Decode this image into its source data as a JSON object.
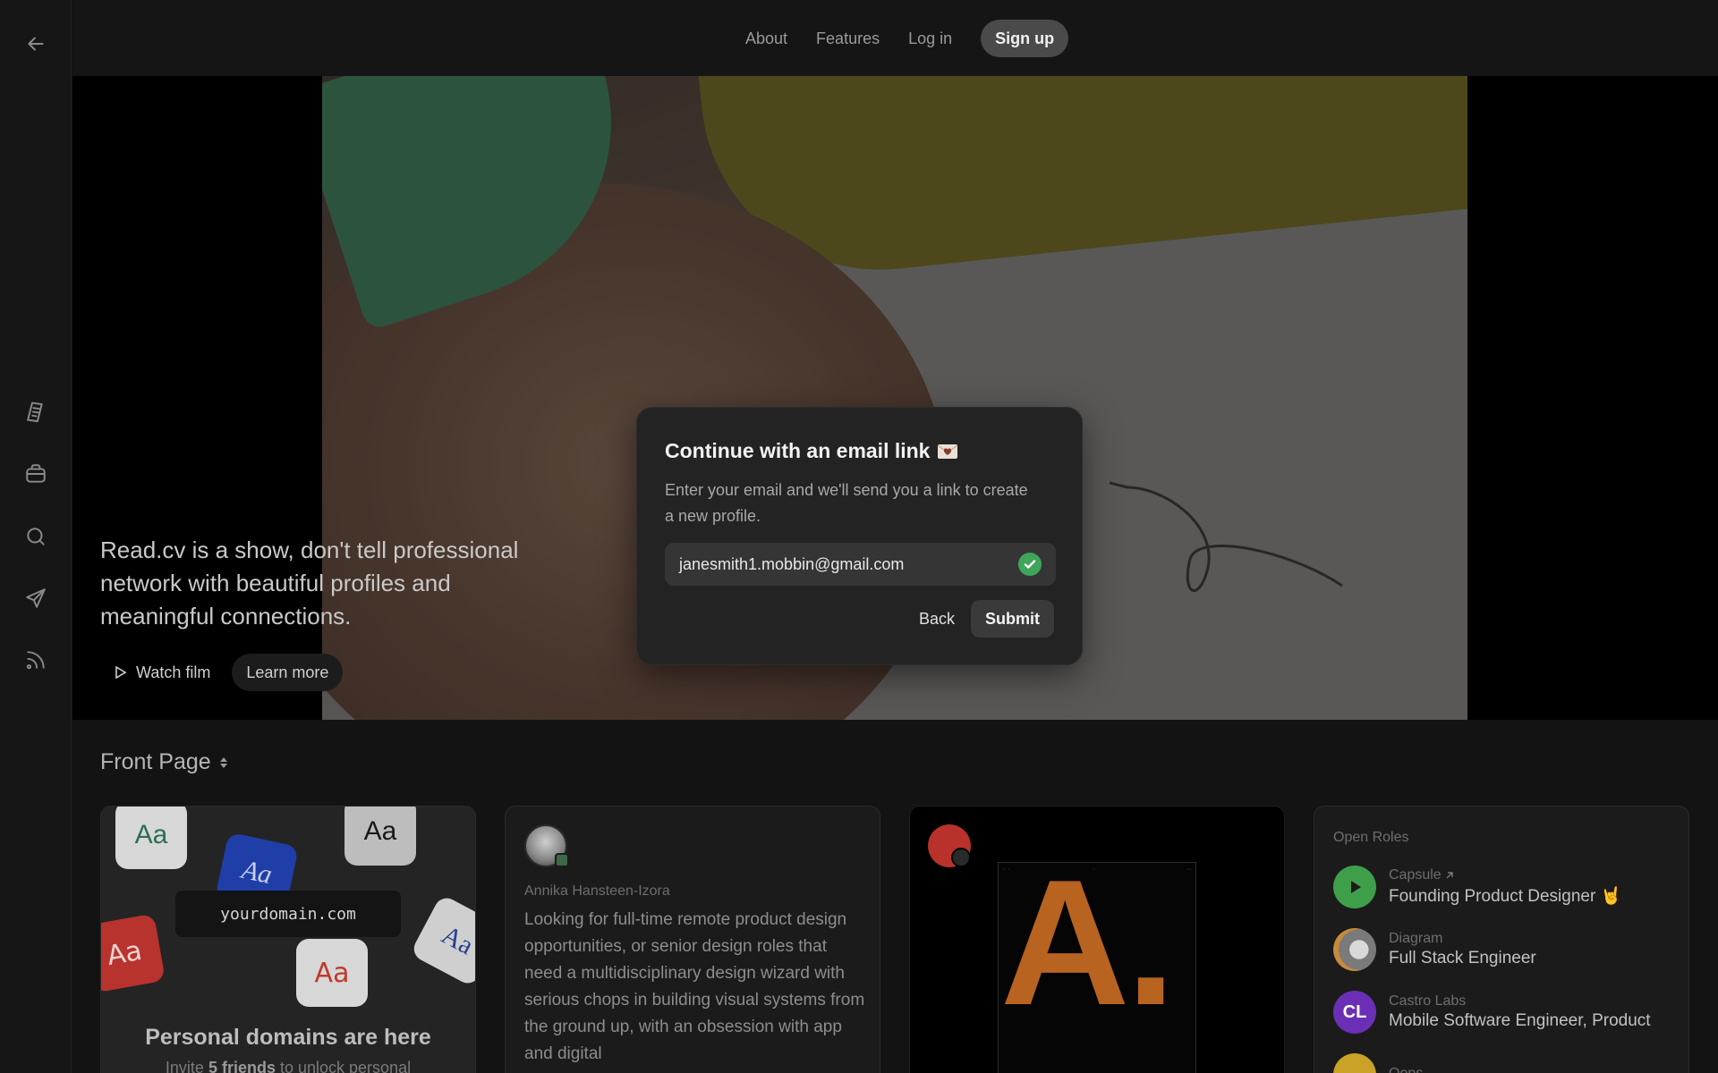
{
  "sidebar": {
    "icons": [
      "back-arrow-icon",
      "document-icon",
      "briefcase-icon",
      "search-icon",
      "send-icon",
      "rss-icon"
    ]
  },
  "nav": {
    "about": "About",
    "features": "Features",
    "login": "Log in",
    "signup": "Sign up"
  },
  "hero": {
    "tagline": "Read.cv is a show, don't tell professional network with beautiful profiles and meaningful connections.",
    "watch_film": "Watch film",
    "learn_more": "Learn more"
  },
  "modal": {
    "title": "Continue with an email link",
    "description": "Enter your email and we'll send you a link to create a new profile.",
    "email_value": "janesmith1.mobbin@gmail.com",
    "back_label": "Back",
    "submit_label": "Submit",
    "email_valid": true
  },
  "front_page": {
    "title": "Front Page",
    "card_domains": {
      "domain": "yourdomain.com",
      "tiles": [
        "Aa",
        "Aa",
        "Aa",
        "Aa",
        "Aa",
        "Aa"
      ],
      "title": "Personal domains are here",
      "sub_prefix": "Invite ",
      "sub_bold": "5 friends",
      "sub_suffix": " to unlock personal"
    },
    "card_post": {
      "author": "Annika Hansteen-Izora",
      "text": "Looking for full-time remote product design opportunities, or senior design roles that need a multidisciplinary design wizard with serious chops in building visual systems from the ground up, with an obsession with app and digital"
    },
    "card_poster": {
      "big_text": "A."
    },
    "card_roles": {
      "label": "Open Roles",
      "roles": [
        {
          "company": "Capsule",
          "title": "Founding Product Designer",
          "logo_text": "",
          "logo_color": "#3f9e4a",
          "external": true
        },
        {
          "company": "Diagram",
          "title": "Full Stack Engineer",
          "logo_text": "",
          "logo_color": "#6a6a6a",
          "external": false
        },
        {
          "company": "Castro Labs",
          "title": "Mobile Software Engineer, Product",
          "logo_text": "CL",
          "logo_color": "#6b2fb5",
          "external": false
        },
        {
          "company": "Oops",
          "title": "",
          "logo_text": "",
          "logo_color": "#c9a227",
          "external": false
        }
      ]
    }
  }
}
